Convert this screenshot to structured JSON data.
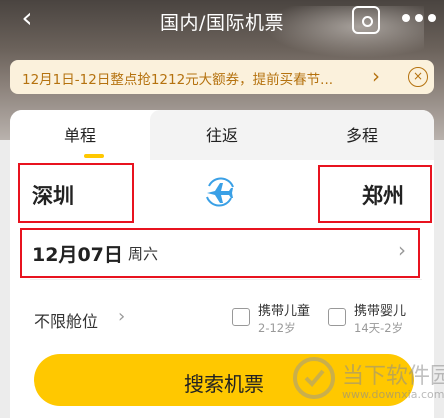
{
  "nav": {
    "back_icon": "chevron-left-icon",
    "title": "国内/国际机票",
    "frame_icon": "screenshot-icon",
    "more_icon": "more-dots-icon"
  },
  "banner": {
    "text": "12月1日-12日整点抢1212元大额券，提前买春节...",
    "arrow": "›",
    "close": "×"
  },
  "tabs": [
    "单程",
    "往返",
    "多程"
  ],
  "trip": {
    "from_city": "深圳",
    "to_city": "郑州",
    "swap_icon": "plane-swap-icon",
    "date": "12月07日",
    "weekday": "周六",
    "date_arrow": "›"
  },
  "options": {
    "cabin_label": "不限舱位",
    "cabin_arrow": "›",
    "child_label": "携带儿童",
    "child_sub": "2-12岁",
    "infant_label": "携带婴儿",
    "infant_sub": "14天-2岁"
  },
  "search_button": "搜索机票",
  "watermark": {
    "text": "当下软件园",
    "url": "www.downxia.com"
  },
  "colors": {
    "accent": "#ffc800",
    "highlight": "#e8131f",
    "banner_text": "#b5720f",
    "swap_blue": "#3aa0e6"
  }
}
